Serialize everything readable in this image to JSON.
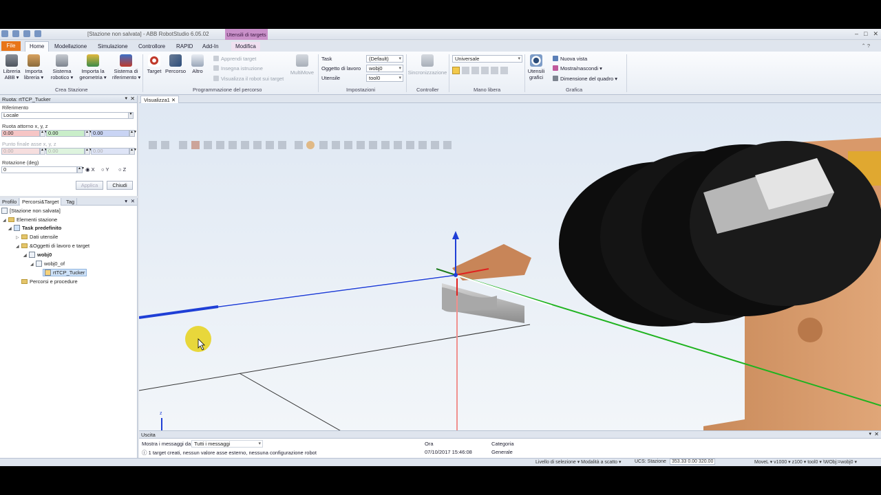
{
  "titlebar": {
    "title": "[Stazione non salvata] - ABB RobotStudio 6.05.02",
    "context_label": "Utensili di targets"
  },
  "tabs": [
    "File",
    "Home",
    "Modellazione",
    "Simulazione",
    "Controllore",
    "RAPID",
    "Add-In",
    "Modifica"
  ],
  "ribbon": {
    "crea_stazione": {
      "group": "Crea Stazione",
      "libreria_abb": "Libreria\nABB ▾",
      "importa_libreria": "Importa\nlibreria ▾",
      "sistema_robotico": "Sistema\nrobotico ▾",
      "importa_geometria": "Importa la\ngeometria ▾",
      "sistema_riferimento": "Sistema di\nriferimento ▾"
    },
    "programmazione": {
      "group": "Programmazione del percorso",
      "target": "Target",
      "percorso": "Percorso",
      "altro": "Altro",
      "apprendi_target": "Apprendi target",
      "insegna_istruzione": "Insegna istruzione",
      "visualizza_robot": "Visualizza il robot sui target",
      "multimove": "MultiMove"
    },
    "impostazioni": {
      "group": "Impostazioni",
      "task_label": "Task",
      "task_value": "(Default)",
      "oggetto_label": "Oggetto di lavoro",
      "oggetto_value": "wobj0",
      "utensile_label": "Utensile",
      "utensile_value": "tool0"
    },
    "controller": {
      "group": "Controller",
      "sincronizzazione": "Sincronizzazione"
    },
    "mano_libera": {
      "group": "Mano libera",
      "frame_value": "Universale"
    },
    "grafica": {
      "group": "Grafica",
      "utensili_grafici": "Utensili\ngrafici",
      "nuova_vista": "Nuova vista",
      "mostra_nascondi": "Mostra/nascondi ▾",
      "dimensione_quadro": "Dimensione del quadro ▾"
    }
  },
  "rotate_panel": {
    "title": "Ruota: rtTCP_Tucker",
    "riferimento_label": "Riferimento",
    "riferimento_value": "Locale",
    "asse_label": "Ruota attorno x, y, z",
    "asse_values": [
      "0.00",
      "0.00",
      "0.00"
    ],
    "finale_label": "Punto finale asse x, y, z",
    "finale_values": [
      "0.00",
      "0.00",
      "0.00"
    ],
    "rotazione_label": "Rotazione (deg)",
    "rotazione_value": "0",
    "axes": [
      "X",
      "Y",
      "Z"
    ],
    "selected_axis": "X",
    "applica": "Applica",
    "chiudi": "Chiudi"
  },
  "tree_panel": {
    "tabs": [
      "Profilo",
      "Percorsi&Target",
      "Tag"
    ],
    "active_tab": "Percorsi&Target",
    "items": [
      {
        "label": "[Stazione non salvata]",
        "level": 0
      },
      {
        "label": "Elementi stazione",
        "level": 1
      },
      {
        "label": "Task predefinito",
        "level": 2
      },
      {
        "label": "Dati utensile",
        "level": 3
      },
      {
        "label": "&Oggetti di lavoro e target",
        "level": 3
      },
      {
        "label": "wobj0",
        "level": 4
      },
      {
        "label": "wobj0_of",
        "level": 5
      },
      {
        "label": "rtTCP_Tucker",
        "level": 6
      },
      {
        "label": "Percorsi e procedure",
        "level": 3
      }
    ]
  },
  "view": {
    "tab_label": "Visualizza1"
  },
  "output": {
    "title": "Uscita",
    "filter_label": "Mostra i messaggi da:",
    "filter_value": "Tutti i messaggi",
    "col_ora": "Ora",
    "col_categoria": "Categoria",
    "message": "1 target creati, nessun valore asse esterno, nessuna configurazione robot",
    "time": "07/10/2017 15:46:08",
    "category": "Generale"
  },
  "status": {
    "selezione": "Livello di selezione ▾ Modalità a scatto ▾",
    "ucs_label": "UCS: Stazione",
    "coords": "353.33  0.00  320.00",
    "move": "MoveL ▾ v1000 ▾ z100 ▾ tool0 ▾ \\WObj:=wobj0 ▾"
  },
  "colors": {
    "file_tab": "#e8751a",
    "context_tab": "#c990c9",
    "axis_x": "#e0201e",
    "axis_y": "#1fb31f",
    "axis_z": "#1f3fd6",
    "robot_orange": "#d9996a",
    "cursor_highlight": "#e6d21a"
  }
}
